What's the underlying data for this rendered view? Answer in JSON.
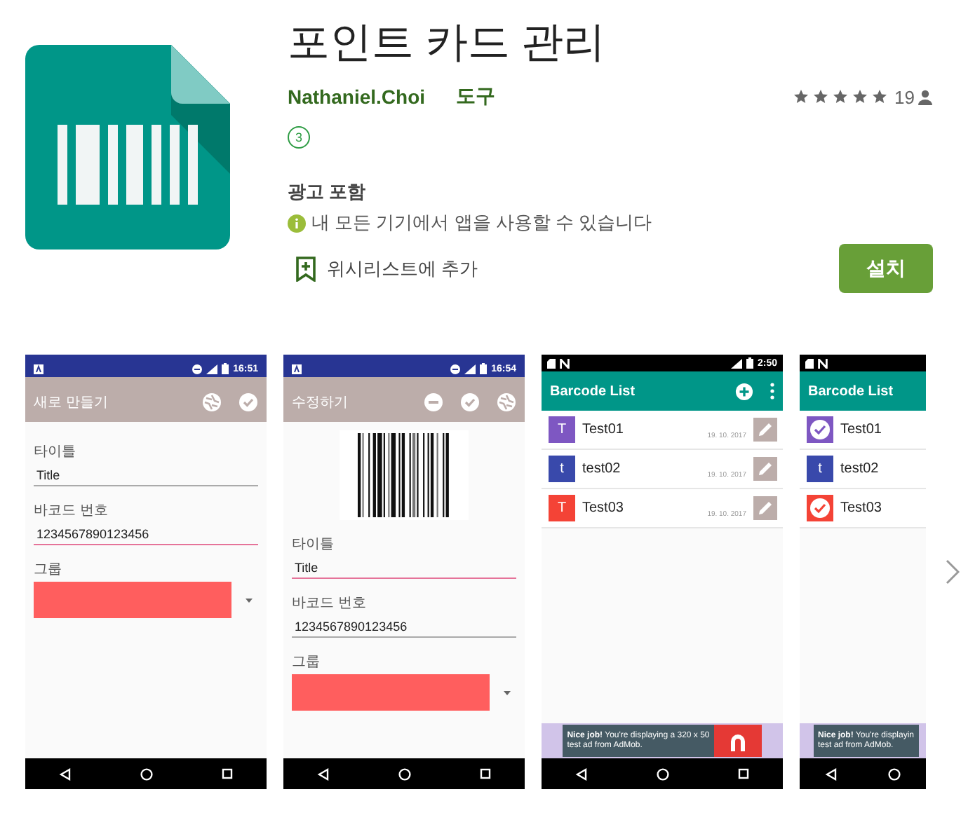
{
  "app": {
    "title": "포인트 카드 관리",
    "developer": "Nathaniel.Choi",
    "category": "도구",
    "rating": {
      "stars": 5,
      "count": "19"
    },
    "content_rating": "3",
    "ads": "광고 포함",
    "availability": "내 모든 기기에서 앱을 사용할 수 있습니다",
    "wishlist": "위시리스트에 추가",
    "install": "설치"
  },
  "screenshots": [
    {
      "kind": "form",
      "partial": false,
      "time": "16:51",
      "toolbar": {
        "title": "새로 만들기",
        "actions": [
          {
            "kind": "shutter"
          },
          {
            "kind": "check"
          }
        ]
      },
      "barcode": false,
      "fields": [
        {
          "label": "타이틀",
          "value": "Title",
          "focused": false
        },
        {
          "label": "바코드 번호",
          "value": "1234567890123456",
          "focused": true
        }
      ],
      "group": {
        "label": "그룹",
        "color": "#ff5e5e"
      }
    },
    {
      "kind": "form",
      "partial": false,
      "time": "16:54",
      "toolbar": {
        "title": "수정하기",
        "actions": [
          {
            "kind": "minus"
          },
          {
            "kind": "check"
          },
          {
            "kind": "shutter"
          }
        ]
      },
      "barcode": true,
      "fields": [
        {
          "label": "타이틀",
          "value": "Title",
          "focused": true
        },
        {
          "label": "바코드 번호",
          "value": "1234567890123456",
          "focused": false
        }
      ],
      "group": {
        "label": "그룹",
        "color": "#ff5e5e"
      }
    },
    {
      "kind": "list",
      "partial": false,
      "time": "2:50",
      "toolbar": {
        "title": "Barcode List",
        "actions": [
          {
            "kind": "add"
          },
          {
            "kind": "more"
          }
        ]
      },
      "items": [
        {
          "initial": "T",
          "name": "Test01",
          "date": "19. 10. 2017",
          "color": "#7e57c2",
          "selected": false
        },
        {
          "initial": "t",
          "name": "test02",
          "date": "19. 10. 2017",
          "color": "#3949ab",
          "selected": false
        },
        {
          "initial": "T",
          "name": "Test03",
          "date": "19. 10. 2017",
          "color": "#f44336",
          "selected": false
        }
      ],
      "ad": {
        "lines": [
          "**Nice job!** You're displaying a 320 x 50",
          "test ad from AdMob."
        ],
        "logo": true
      }
    },
    {
      "kind": "list",
      "partial": true,
      "toolbar": {
        "title": "Barcode List"
      },
      "items": [
        {
          "name": "Test01",
          "color": "#7e57c2",
          "selected": true
        },
        {
          "initial": "t",
          "name": "test02",
          "color": "#3949ab",
          "selected": false
        },
        {
          "name": "Test03",
          "color": "#f44336",
          "selected": true
        }
      ],
      "ad": {
        "lines": [
          "**Nice job!** You're displayin",
          "test ad from AdMob."
        ],
        "logo": false
      }
    }
  ]
}
